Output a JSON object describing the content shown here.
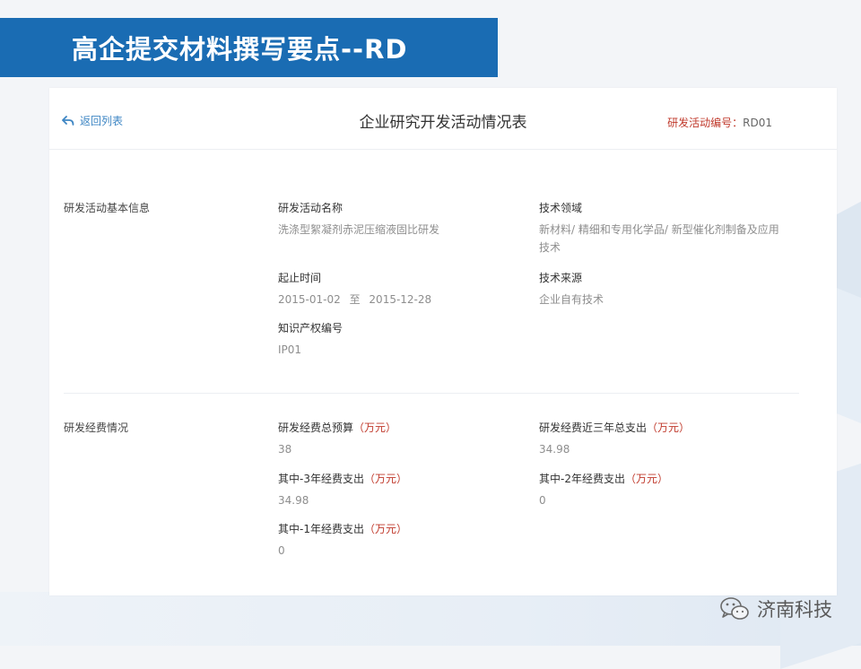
{
  "slide": {
    "title": "高企提交材料撰写要点--RD"
  },
  "header": {
    "back_label": "返回列表",
    "title": "企业研究开发活动情况表",
    "rd_number_label": "研发活动编号：",
    "rd_number_value": "RD01"
  },
  "basic_info": {
    "section_label": "研发活动基本信息",
    "activity_name": {
      "label": "研发活动名称",
      "value": "洗涤型絮凝剂赤泥压缩液固比研发"
    },
    "tech_field": {
      "label": "技术领域",
      "value": "新材料/ 精细和专用化学品/ 新型催化剂制备及应用技术"
    },
    "period": {
      "label": "起止时间",
      "start": "2015-01-02",
      "sep": "至",
      "end": "2015-12-28"
    },
    "tech_source": {
      "label": "技术来源",
      "value": "企业自有技术"
    },
    "ip_number": {
      "label": "知识产权编号",
      "value": "IP01"
    }
  },
  "funding": {
    "section_label": "研发经费情况",
    "unit": "（万元）",
    "total_budget": {
      "label": "研发经费总预算",
      "value": "38"
    },
    "three_year_total": {
      "label": "研发经费近三年总支出",
      "value": "34.98"
    },
    "year_minus_3": {
      "label": "其中-3年经费支出",
      "value": "34.98"
    },
    "year_minus_2": {
      "label": "其中-2年经费支出",
      "value": "0"
    },
    "year_minus_1": {
      "label": "其中-1年经费支出",
      "value": "0"
    }
  },
  "watermark": {
    "text": "济南科技"
  },
  "colors": {
    "banner": "#1a6cb3",
    "link": "#3e86c4",
    "accent_red": "#c0392b"
  }
}
